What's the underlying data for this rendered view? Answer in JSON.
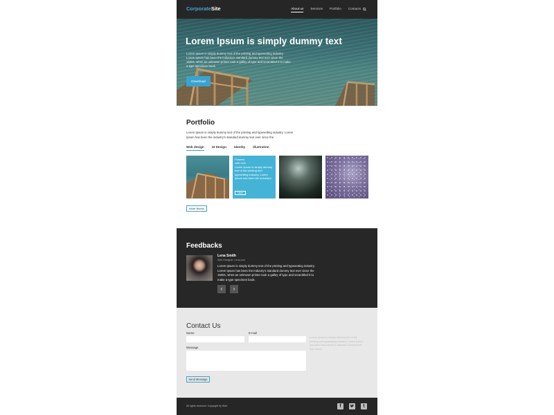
{
  "header": {
    "logo_part1": "Corporate",
    "logo_part2": "Site",
    "nav": [
      "About us",
      "Services",
      "Portfolio",
      "Contacts"
    ],
    "search_icon": "search-icon"
  },
  "hero": {
    "title": "Lorem Ipsum is simply dummy  text",
    "text": "Lorem Ipsum is simply dummy text of the printing and typesetting industry. Lorem Ipsum has been the industry's standard dummy text ever since the 1500s, when an unknown printer took a galley of type and scrambled it to make a type specimen book.",
    "button": "Download"
  },
  "portfolio": {
    "title": "Portfolio",
    "text": "Lorem Ipsum is simply dummy text of the printing and typesetting industry. Lorem Ipsum has been the industry's standard dummy text ever since the",
    "tabs": [
      "Web design",
      "UI Design",
      "Identity",
      "Illustration"
    ],
    "overlay_title": "Flowers",
    "overlay_sub": "web.com",
    "overlay_text": "Lorem Ipsum is simply dummy text of the printing and typesetting industry. Lorem Ipsum has been the industry's",
    "view_label": "View",
    "more_button": "More Works"
  },
  "feedbacks": {
    "title": "Feedbacks",
    "name": "Lena Smith",
    "role": "Web Designer, Lena.com",
    "text": "Lorem Ipsum is simply dummy text of the printing and typesetting industry. Lorem Ipsum has been the industry's standard dummy text ever since the 1500s, when an unknown printer took a galley of type and scrambled it to make a type specimen book.",
    "prev_icon": "chevron-left-icon",
    "next_icon": "chevron-right-icon"
  },
  "contact": {
    "title": "Contact Us",
    "name_label": "Name",
    "email_label": "E-mail",
    "message_label": "Message",
    "side_text": "Lorem Ipsum is simply dummy text of the printing and typesetting industry. Lorem Ipsum has been the industry's standard dummy text ever since.",
    "send_button": "Send Message"
  },
  "footer": {
    "copyright": "All rights reserved. Copyright by Web",
    "social": [
      "facebook-icon",
      "twitter-icon",
      "tumblr-icon"
    ]
  },
  "colors": {
    "accent": "#3aa2cf",
    "dark": "#262626",
    "contact_bg": "#e8e8e8"
  }
}
